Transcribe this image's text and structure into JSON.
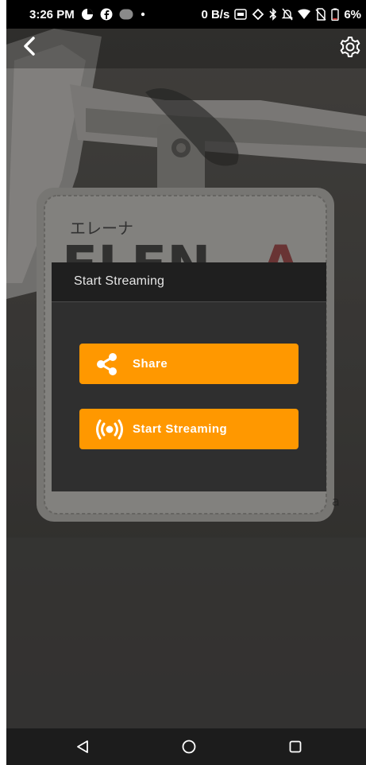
{
  "status_bar": {
    "time": "3:26 PM",
    "net_speed": "0 B/s",
    "battery": "6%",
    "icons": [
      "data-saver-icon",
      "facebook-icon",
      "recorder-icon",
      "dot-icon",
      "ar-icon",
      "sync-icon",
      "bluetooth-icon",
      "mute-icon",
      "wifi-icon",
      "no-sim-icon",
      "battery-icon"
    ]
  },
  "top_bar": {
    "back_icon": "chevron-left-icon",
    "settings_icon": "gear-icon"
  },
  "dialog": {
    "title": "Start Streaming",
    "share_label": "Share",
    "share_icon": "share-icon",
    "stream_label": "Start Streaming",
    "stream_icon": "broadcast-icon",
    "button_color": "#ff9800"
  },
  "nav_bar": {
    "icons": [
      "back-triangle-icon",
      "home-circle-icon",
      "recents-square-icon"
    ]
  }
}
